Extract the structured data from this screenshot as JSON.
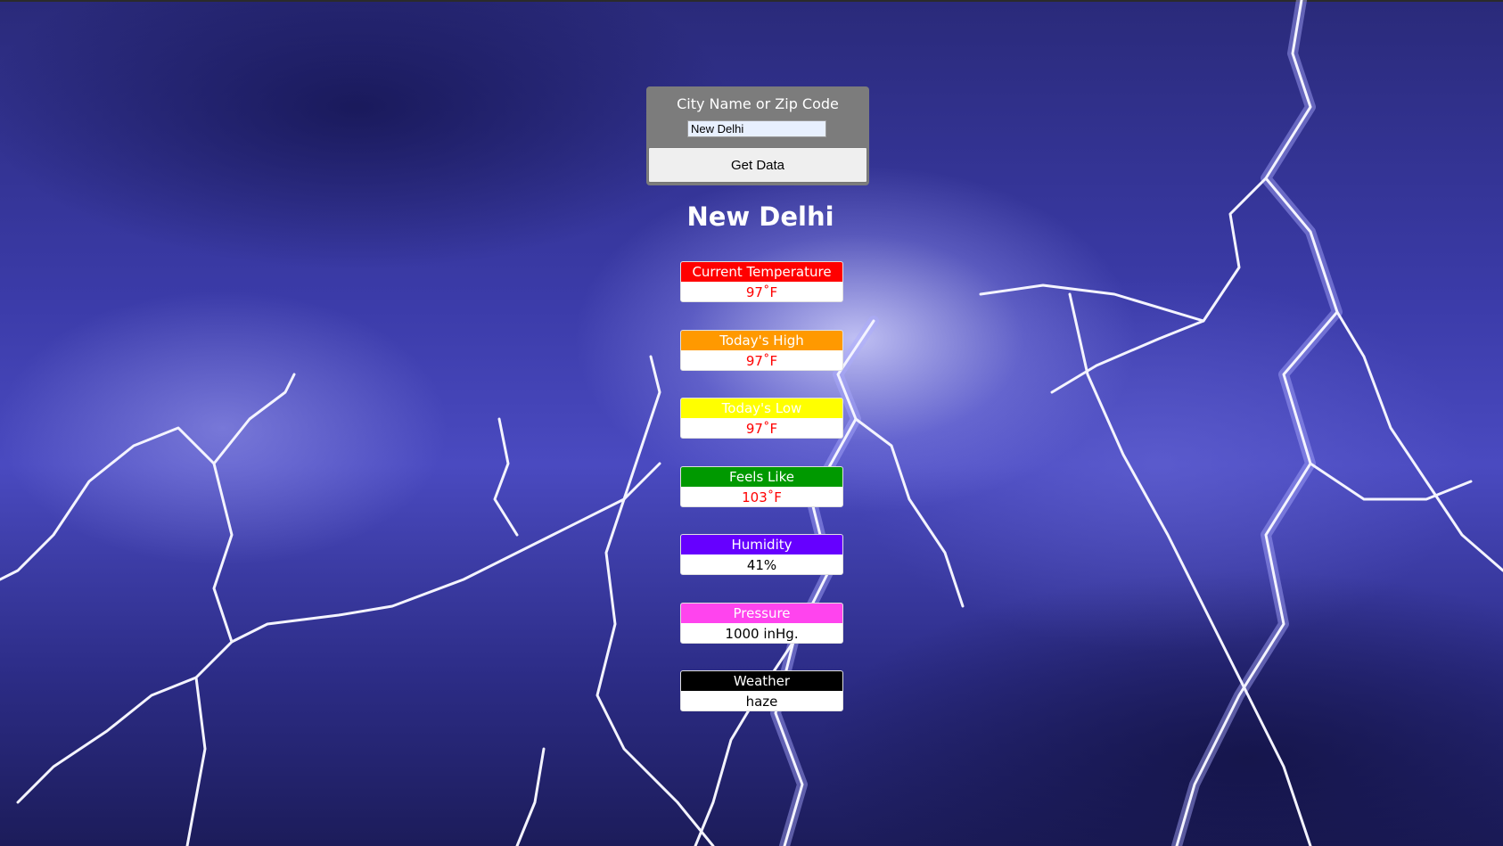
{
  "search": {
    "label": "City Name or Zip Code",
    "value": "New Delhi",
    "button_label": "Get Data"
  },
  "city": "New Delhi",
  "cards": [
    {
      "label": "Current Temperature",
      "value": "97˚F",
      "head_color": "#ff0000",
      "value_color": "#ff0000"
    },
    {
      "label": "Today's High",
      "value": "97˚F",
      "head_color": "#ff9900",
      "value_color": "#ff0000"
    },
    {
      "label": "Today's Low",
      "value": "97˚F",
      "head_color": "#ffff00",
      "value_color": "#ff0000"
    },
    {
      "label": "Feels Like",
      "value": "103˚F",
      "head_color": "#009900",
      "value_color": "#ff0000"
    },
    {
      "label": "Humidity",
      "value": "41%",
      "head_color": "#6600ff",
      "value_color": "#000000"
    },
    {
      "label": "Pressure",
      "value": "1000 inHg.",
      "head_color": "#ff44ee",
      "value_color": "#000000"
    },
    {
      "label": "Weather",
      "value": "haze",
      "head_color": "#000000",
      "value_color": "#000000"
    }
  ]
}
